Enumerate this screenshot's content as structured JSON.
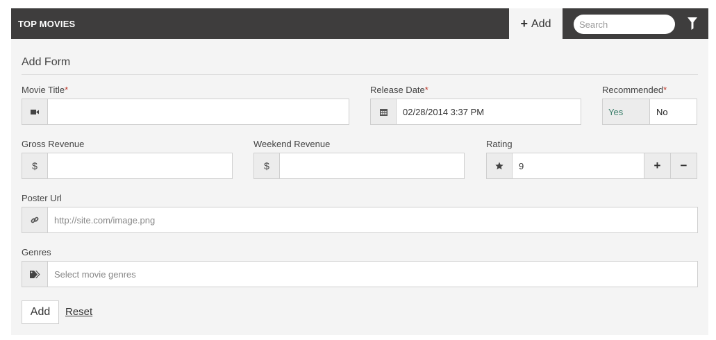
{
  "header": {
    "title": "TOP MOVIES",
    "add_tab_label": "Add",
    "search_placeholder": "Search"
  },
  "form": {
    "title": "Add Form",
    "movie_title": {
      "label": "Movie Title",
      "required_mark": "*",
      "value": "",
      "placeholder": ""
    },
    "release_date": {
      "label": "Release Date",
      "required_mark": "*",
      "value": "02/28/2014 3:37 PM"
    },
    "recommended": {
      "label": "Recommended",
      "required_mark": "*",
      "options": [
        "Yes",
        "No"
      ],
      "selected": "Yes"
    },
    "gross_revenue": {
      "label": "Gross Revenue",
      "addon": "$",
      "value": ""
    },
    "weekend_revenue": {
      "label": "Weekend Revenue",
      "addon": "$",
      "value": ""
    },
    "rating": {
      "label": "Rating",
      "value": "9",
      "increment": "+",
      "decrement": "−"
    },
    "poster_url": {
      "label": "Poster Url",
      "placeholder": "http://site.com/image.png",
      "value": ""
    },
    "genres": {
      "label": "Genres",
      "placeholder": "Select movie genres",
      "value": ""
    },
    "actions": {
      "submit_label": "Add",
      "reset_label": "Reset"
    }
  },
  "colors": {
    "header_bg": "#3e3d3d",
    "panel_bg": "#f4f4f4",
    "required": "#c0392b",
    "yes_text": "#3a7d6a"
  },
  "icons": [
    "video-camera-icon",
    "calendar-icon",
    "dollar-icon",
    "star-icon",
    "link-icon",
    "tags-icon",
    "filter-icon",
    "plus-icon"
  ]
}
